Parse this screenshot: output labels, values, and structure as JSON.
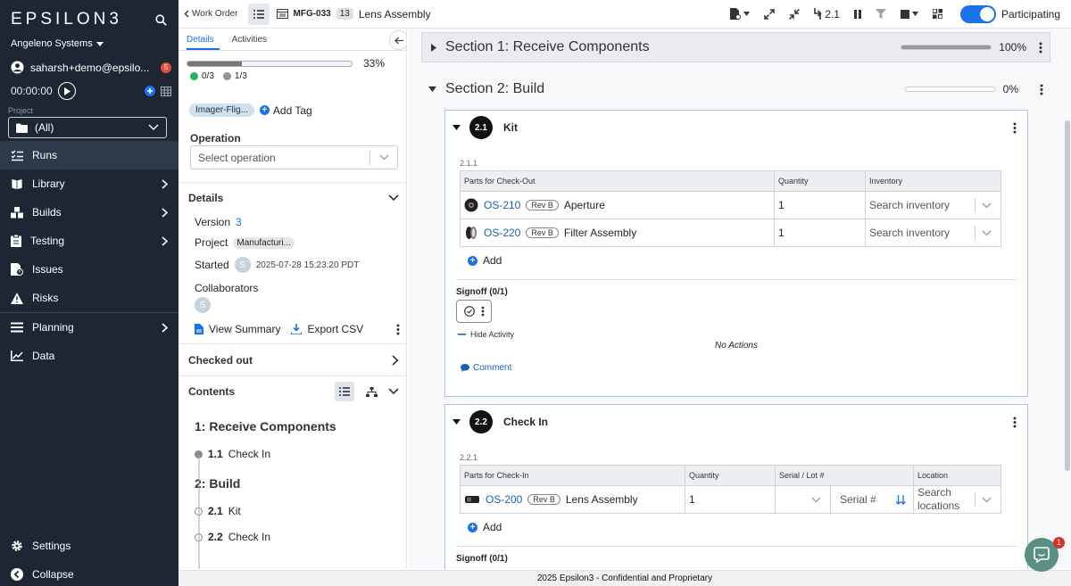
{
  "sidebar": {
    "logo": "EPSILON3",
    "org": "Angeleno Systems",
    "user": "saharsh+demo@epsilo...",
    "notifications": "5",
    "timer": "00:00:00",
    "project_label": "Project",
    "project_value": "(All)",
    "nav": [
      {
        "label": "Runs",
        "icon": "checklist-icon",
        "active": true
      },
      {
        "label": "Library",
        "icon": "book-icon",
        "arrow": true
      },
      {
        "label": "Builds",
        "icon": "cubes-icon",
        "arrow": true
      },
      {
        "label": "Testing",
        "icon": "clipboard-icon",
        "arrow": true
      },
      {
        "label": "Issues",
        "icon": "issue-icon"
      },
      {
        "label": "Risks",
        "icon": "warning-icon"
      },
      {
        "label": "Planning",
        "icon": "bars-icon",
        "arrow": true
      },
      {
        "label": "Data",
        "icon": "chart-icon"
      }
    ],
    "settings": "Settings",
    "collapse": "Collapse"
  },
  "topbar": {
    "back": "Work Order",
    "wo_id": "MFG-033",
    "rev_count": "13",
    "title": "Lens Assembly",
    "step_jump": "2.1",
    "participating": "Participating"
  },
  "panel": {
    "tabs": [
      "Details",
      "Activities"
    ],
    "progress_pct": "33%",
    "progress_fraction": 0.33,
    "count_green": "0/3",
    "count_gray": "1/3",
    "tag": "Imager-Flig...",
    "add_tag": "Add Tag",
    "operation_label": "Operation",
    "operation_placeholder": "Select operation",
    "details_head": "Details",
    "version_label": "Version",
    "version_value": "3",
    "project_label": "Project",
    "project_value": "Manufacturi...",
    "started_label": "Started",
    "started_value": "2025-07-28 15:23:20 PDT",
    "avatar": "S",
    "collaborators_label": "Collaborators",
    "view_summary": "View Summary",
    "export_csv": "Export CSV",
    "checked_out": "Checked out",
    "contents": "Contents",
    "toc": {
      "s1": "1: Receive Components",
      "s1_1_no": "1.1",
      "s1_1": "Check In",
      "s2": "2: Build",
      "s2_1_no": "2.1",
      "s2_1": "Kit",
      "s2_2_no": "2.2",
      "s2_2": "Check In"
    }
  },
  "main": {
    "section1": {
      "title": "Section 1: Receive Components",
      "pct": "100%",
      "fraction": 1.0
    },
    "section2": {
      "title": "Section 2: Build",
      "pct": "0%",
      "fraction": 0.0
    },
    "step21": {
      "no": "2.1",
      "title": "Kit",
      "sub_id": "2.1.1",
      "headers": [
        "Parts for Check-Out",
        "Quantity",
        "Inventory"
      ],
      "rows": [
        {
          "part": "OS-210",
          "rev": "Rev B",
          "name": "Aperture",
          "qty": "1",
          "inv": "Search inventory"
        },
        {
          "part": "OS-220",
          "rev": "Rev B",
          "name": "Filter Assembly",
          "qty": "1",
          "inv": "Search inventory"
        }
      ],
      "add": "Add",
      "signoff": "Signoff (0/1)",
      "hide_activity": "Hide Activity",
      "no_actions": "No Actions",
      "comment": "Comment"
    },
    "step22": {
      "no": "2.2",
      "title": "Check In",
      "sub_id": "2.2.1",
      "headers": [
        "Parts for Check-In",
        "Quantity",
        "Serial / Lot #",
        "Location"
      ],
      "row": {
        "part": "OS-200",
        "rev": "Rev B",
        "name": "Lens Assembly",
        "qty": "1",
        "serial": "Serial #",
        "location": "Search locations"
      },
      "add": "Add",
      "signoff": "Signoff (0/1)"
    }
  },
  "footer": "2025 Epsilon3 - Confidential and Proprietary",
  "chat_badge": "1",
  "colors": {
    "sidebar": "#1e2633",
    "accent": "#1a73e8",
    "green": "#27ae60"
  }
}
